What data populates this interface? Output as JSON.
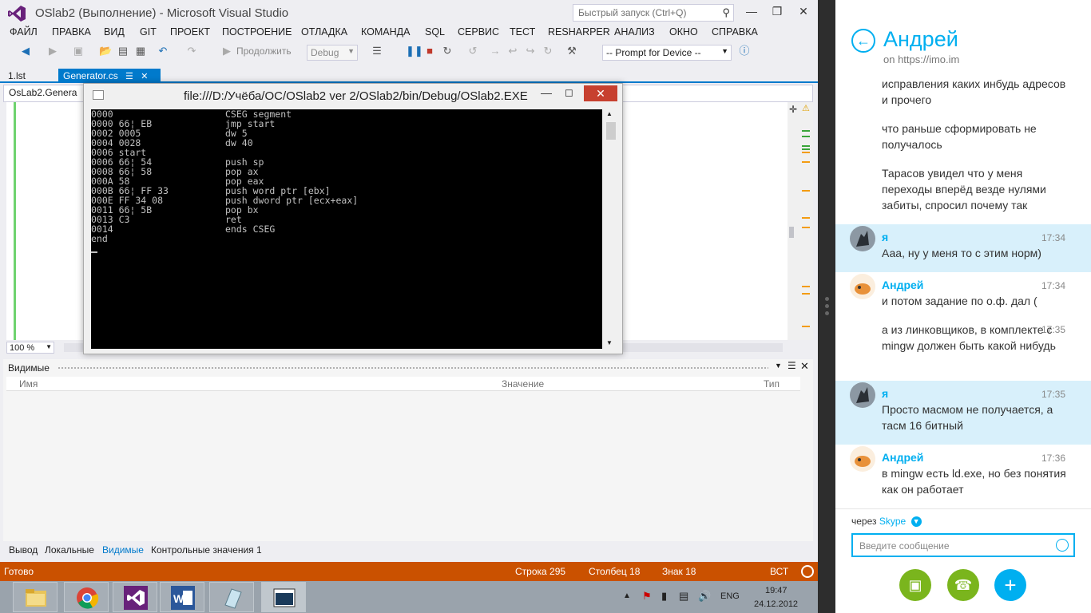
{
  "vs": {
    "title": "OSlab2 (Выполнение) - Microsoft Visual Studio",
    "quick_launch_placeholder": "Быстрый запуск (Ctrl+Q)",
    "menu": [
      "ФАЙЛ",
      "ПРАВКА",
      "ВИД",
      "GIT",
      "ПРОЕКТ",
      "ПОСТРОЕНИЕ",
      "ОТЛАДКА",
      "КОМАНДА",
      "SQL",
      "СЕРВИС",
      "ТЕСТ",
      "RESHARPER",
      "АНАЛИЗ",
      "ОКНО",
      "СПРАВКА"
    ],
    "toolbar": {
      "continue_label": "Продолжить",
      "config": "Debug",
      "prompt_device": "-- Prompt for Device --"
    },
    "tabs": [
      "1.lst",
      "Generator.cs"
    ],
    "nav_left": "OsLab2.Genera",
    "zoom": "100 %",
    "watch": {
      "title": "Видимые",
      "col_name": "Имя",
      "col_value": "Значение",
      "col_type": "Тип"
    },
    "bottom_tabs": [
      "Вывод",
      "Локальные",
      "Видимые",
      "Контрольные значения 1"
    ],
    "status": {
      "ready": "Готово",
      "line": "Строка 295",
      "col": "Столбец 18",
      "char": "Знак 18",
      "ins": "ВСТ"
    }
  },
  "console": {
    "title": "file:///D:/Учёба/ОС/OSlab2 ver 2/OSlab2/bin/Debug/OSlab2.EXE",
    "lines": [
      {
        "addr": "0000",
        "code": "CSEG segment"
      },
      {
        "addr": "0000 66¦ EB",
        "code": "jmp start"
      },
      {
        "addr": "0002 0005",
        "code": "dw 5"
      },
      {
        "addr": "0004 0028",
        "code": "dw 40"
      },
      {
        "addr": "0006 start",
        "code": ""
      },
      {
        "addr": "0006 66¦ 54",
        "code": "push sp"
      },
      {
        "addr": "0008 66¦ 58",
        "code": "pop ax"
      },
      {
        "addr": "000A 58",
        "code": "pop eax"
      },
      {
        "addr": "000B 66¦ FF 33",
        "code": "push word ptr [ebx]"
      },
      {
        "addr": "000E FF 34 08",
        "code": "push dword ptr [ecx+eax]"
      },
      {
        "addr": "0011 66¦ 5B",
        "code": "pop bx"
      },
      {
        "addr": "0013 C3",
        "code": "ret"
      },
      {
        "addr": "0014",
        "code": "ends CSEG"
      },
      {
        "addr": "end",
        "code": ""
      }
    ]
  },
  "taskbar": {
    "lang": "ENG",
    "time": "19:47",
    "date": "24.12.2012"
  },
  "skype": {
    "contact": "Андрей",
    "contact_sub": "on https://imo.im",
    "messages": [
      {
        "text": "исправления каких инбудь адресов и прочего"
      },
      {
        "text": "что раньше сформировать не получалось"
      },
      {
        "text": "Тарасов увидел что у меня переходы вперёд везде нулями забиты, спросил почему так"
      }
    ],
    "groups": [
      {
        "sender": "я",
        "time": "17:34",
        "text": "Ааа, ну у меня то с этим норм)"
      },
      {
        "sender": "Андрей",
        "time": "17:34",
        "text": "и потом задание по о.ф. дал ("
      },
      {
        "sender": "",
        "time": "17:35",
        "text": "а из линковщиков, в комплекте с mingw должен быть какой нибудь"
      },
      {
        "sender": "я",
        "time": "17:35",
        "text": "Просто масмом не получается, а тасм 16 битный"
      },
      {
        "sender": "Андрей",
        "time": "17:36",
        "text": "в mingw есть ld.exe, но без понятия как он работает"
      }
    ],
    "via_label": "через",
    "via_service": "Skype",
    "input_placeholder": "Введите сообщение"
  },
  "colors": {
    "vs_accent": "#007acc",
    "status_bar": "#ca5100",
    "skype_blue": "#00aff0",
    "video_btn": "#7ab51d",
    "add_btn": "#00aff0"
  }
}
